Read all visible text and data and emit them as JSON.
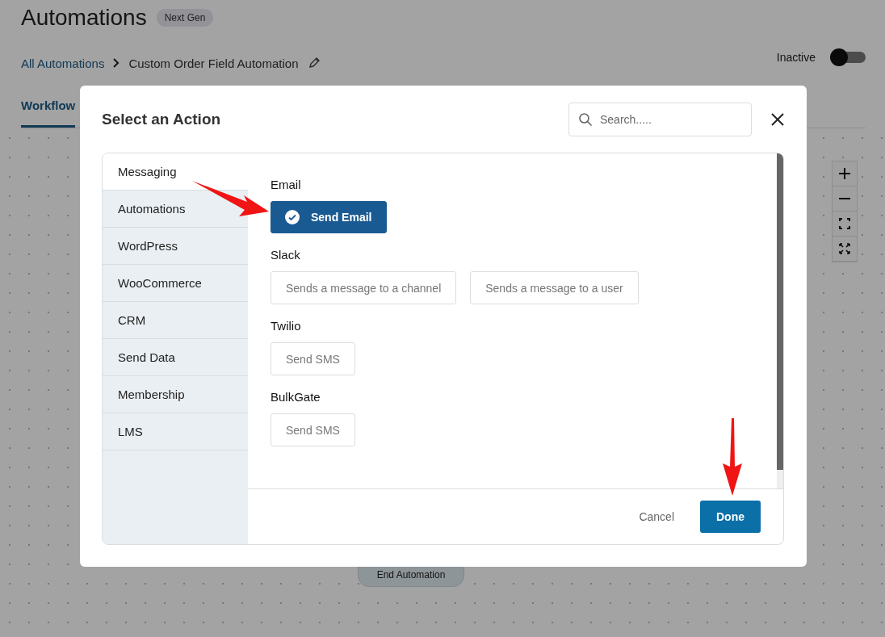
{
  "page": {
    "title": "Automations",
    "badge": "Next Gen",
    "breadcrumb": [
      {
        "label": "All Automations",
        "kind": "link"
      },
      {
        "label": "Custom Order Field Automation",
        "kind": "current"
      }
    ],
    "status_label": "Inactive",
    "active": false,
    "tabs": [
      {
        "label": "Workflow",
        "selected": true
      }
    ],
    "canvas_nodes": [
      {
        "label": "End Automation"
      }
    ]
  },
  "modal": {
    "title": "Select an Action",
    "search": {
      "placeholder": "Search....."
    },
    "categories": [
      {
        "label": "Messaging",
        "selected": true
      },
      {
        "label": "Automations",
        "selected": false
      },
      {
        "label": "WordPress",
        "selected": false
      },
      {
        "label": "WooCommerce",
        "selected": false
      },
      {
        "label": "CRM",
        "selected": false
      },
      {
        "label": "Send Data",
        "selected": false
      },
      {
        "label": "Membership",
        "selected": false
      },
      {
        "label": "LMS",
        "selected": false
      }
    ],
    "groups": [
      {
        "title": "Email",
        "actions": [
          {
            "label": "Send Email",
            "selected": true
          }
        ]
      },
      {
        "title": "Slack",
        "actions": [
          {
            "label": "Sends a message to a channel",
            "selected": false
          },
          {
            "label": "Sends a message to a user",
            "selected": false
          }
        ]
      },
      {
        "title": "Twilio",
        "actions": [
          {
            "label": "Send SMS",
            "selected": false
          }
        ]
      },
      {
        "title": "BulkGate",
        "actions": [
          {
            "label": "Send SMS",
            "selected": false
          }
        ]
      }
    ],
    "cancel": "Cancel",
    "done": "Done"
  }
}
